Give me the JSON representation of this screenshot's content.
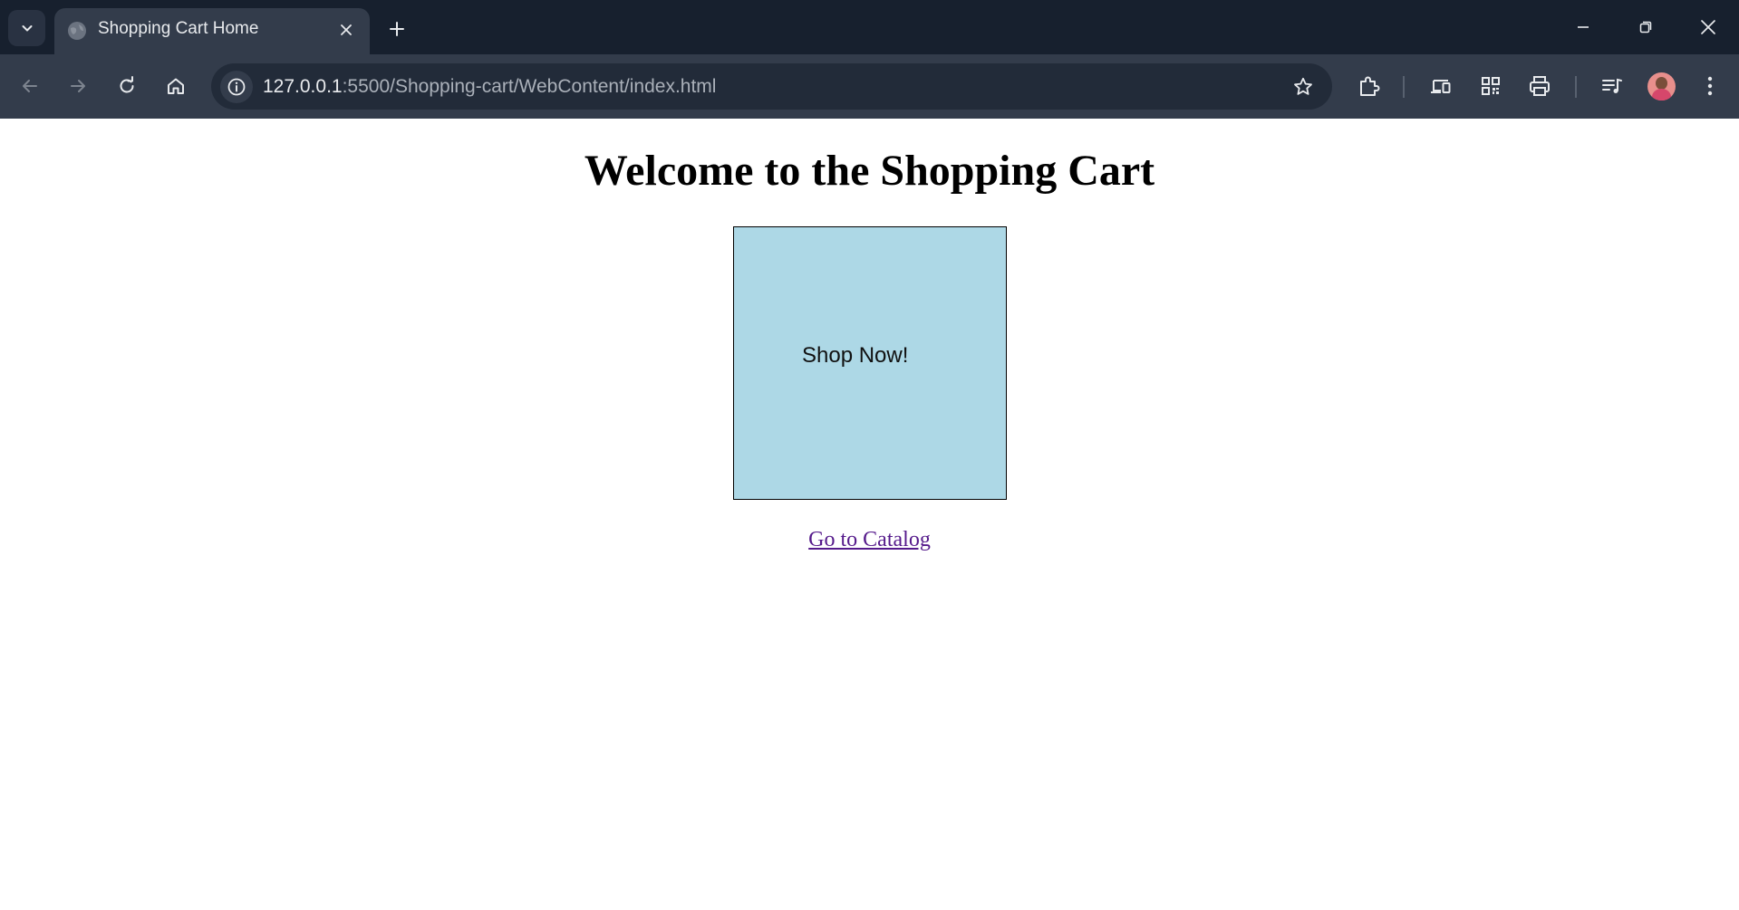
{
  "browser": {
    "tab_title": "Shopping Cart Home",
    "url_host": "127.0.0.1",
    "url_path": ":5500/Shopping-cart/WebContent/index.html",
    "icons": [
      "tab-search-icon",
      "globe-icon",
      "close-icon",
      "plus-icon",
      "minimize-icon",
      "restore-icon",
      "close-window-icon",
      "back-icon",
      "forward-icon",
      "reload-icon",
      "home-icon",
      "info-icon",
      "star-icon",
      "extensions-icon",
      "devices-icon",
      "qr-code-icon",
      "print-icon",
      "media-controls-icon",
      "avatar",
      "menu-icon"
    ],
    "colors": {
      "tabstrip_bg": "#17202e",
      "toolbar_bg": "#333c4b",
      "omnibox_bg": "#222b39"
    }
  },
  "page": {
    "heading": "Welcome to the Shopping Cart",
    "shop_button_label": "Shop Now!",
    "catalog_link": "Go to Catalog",
    "colors": {
      "shop_button_bg": "#add8e6",
      "link_visited": "#551a8b"
    }
  }
}
